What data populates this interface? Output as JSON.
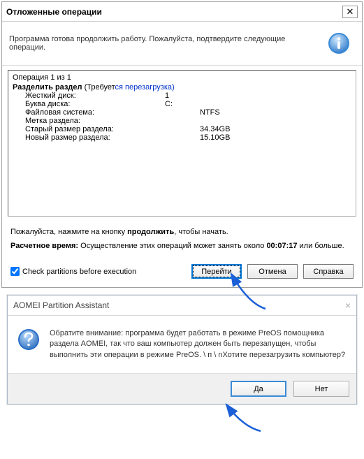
{
  "dialog1": {
    "title": "Отложенные операции",
    "intro": "Программа готова продолжить работу. Пожалуйста, подтвердите следующие операции.",
    "op_count": "Операция 1 из 1",
    "op_title_a": "Разделить раздел",
    "op_title_b": "(Требует",
    "op_title_c": "ся перезагрузка)",
    "rows": {
      "hdd_lbl": "Жесткий диск:",
      "hdd_val": "1",
      "drive_lbl": "Буква диска:",
      "drive_val": "C:",
      "fs_lbl": "Файловая система:",
      "fs_val": "NTFS",
      "label_lbl": "Метка раздела:",
      "label_val": "",
      "old_lbl": "Старый размер раздела:",
      "old_val": "34.34GB",
      "new_lbl": "Новый размер раздела:",
      "new_val": "15.10GB"
    },
    "prompt_pre": "Пожалуйста, нажмите на кнопку ",
    "prompt_bold": "продолжить",
    "prompt_post": ", чтобы начать.",
    "eta_lbl": "Расчетное время:",
    "eta_txt1": " Осуществление этих операций может занять около ",
    "eta_time": "00:07:17",
    "eta_txt2": " или больше.",
    "checkbox": "Check partitions before execution",
    "btn_go": "Перейти",
    "btn_cancel": "Отмена",
    "btn_help": "Справка"
  },
  "dialog2": {
    "title": "AOMEI Partition Assistant",
    "body": "Обратите внимание: программа будет работать в режиме PreOS помощника раздела AOMEI, так что ваш компьютер должен быть перезапущен, чтобы выполнить эти операции в режиме PreOS. \\ п \\ nХотите перезагрузить компьютер?",
    "yes": "Да",
    "no": "Нет"
  }
}
